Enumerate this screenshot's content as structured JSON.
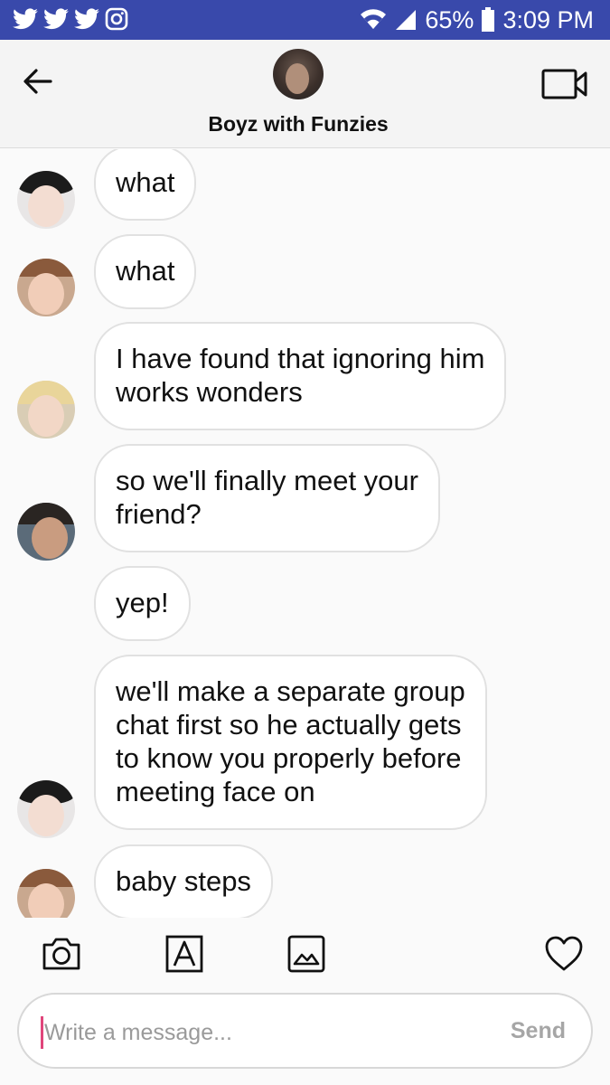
{
  "status_bar": {
    "notification_icons": [
      "twitter-icon",
      "twitter-icon",
      "twitter-icon",
      "instagram-icon"
    ],
    "battery": "65%",
    "time": "3:09 PM"
  },
  "header": {
    "title": "Boyz with Funzies"
  },
  "messages": [
    {
      "text": "what"
    },
    {
      "text": "what"
    },
    {
      "text": "I have found that ignoring him\nworks wonders"
    },
    {
      "text": "so we'll finally meet your\nfriend?"
    },
    {
      "text": "yep!"
    },
    {
      "text": "we'll make a separate group\nchat first so he actually gets\nto know you properly before\nmeeting face on"
    },
    {
      "text": "baby steps"
    }
  ],
  "composer": {
    "placeholder": "Write a message...",
    "send_label": "Send"
  },
  "colors": {
    "status_bar": "#3949ab",
    "bubble_border": "#e1e1e1",
    "cursor": "#e0457b"
  }
}
